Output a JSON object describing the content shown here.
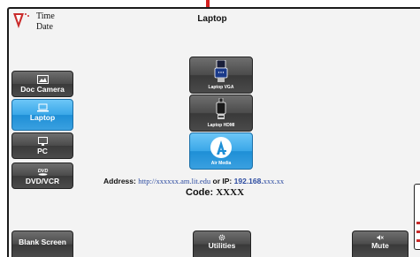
{
  "header": {
    "time": "Time",
    "date": "Date",
    "title": "Laptop"
  },
  "sidebar": {
    "items": [
      {
        "label": "Doc Camera",
        "icon": "picture-icon",
        "active": false
      },
      {
        "label": "Laptop",
        "icon": "laptop-icon",
        "active": true
      },
      {
        "label": "PC",
        "icon": "monitor-icon",
        "active": false
      },
      {
        "label": "DVD/VCR",
        "icon": "dvd-icon",
        "active": false
      }
    ]
  },
  "sources": [
    {
      "label": "Laptop VGA",
      "icon": "vga-connector-icon",
      "active": false
    },
    {
      "label": "Laptop HDMI",
      "icon": "hdmi-connector-icon",
      "active": false
    },
    {
      "label": "Air Media",
      "icon": "air-media-icon",
      "active": true
    }
  ],
  "info": {
    "address_label": "Address:",
    "address_prefix": "http://",
    "address_url": "xxxxxx.am.lit.edu",
    "or_ip_label": "or IP:",
    "ip_prefix": "192.168.",
    "ip_suffix": "xxx.xx",
    "code_label": "Code:",
    "code_value": "XXXX"
  },
  "footer": {
    "blank_screen": "Blank Screen",
    "utilities": "Utilities",
    "mute": "Mute"
  },
  "colors": {
    "active_blue": "#3aa7e8",
    "button_gray": "#4a4a4a",
    "link_blue": "#2b4aa0",
    "accent_red": "#d42020"
  }
}
